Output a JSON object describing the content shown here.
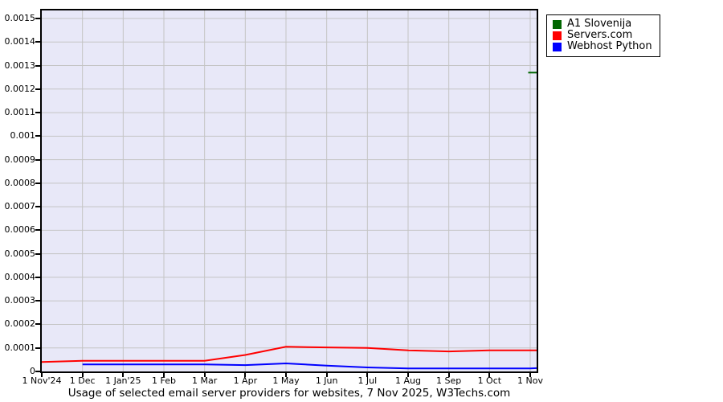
{
  "caption": "Usage of selected email server providers for websites, 7 Nov 2025, W3Techs.com",
  "chart_data": {
    "type": "line",
    "title": "Usage of selected email server providers for websites, 7 Nov 2025, W3Techs.com",
    "ylim": [
      0,
      0.0015
    ],
    "grid": true,
    "legend_position": "top-right-outside",
    "plot_bg": "#e8e8f8",
    "grid_color": "#c4c4c4",
    "axis_color": "#000000",
    "x_axis_note": "month_index 0 = 1 Nov 2024, 12 = 1 Nov 2025; axis extends to 12.16 = 7 Nov 2025",
    "y_ticks": [
      {
        "value": 0,
        "label": "0"
      },
      {
        "value": 0.0001,
        "label": "0.0001"
      },
      {
        "value": 0.0002,
        "label": "0.0002"
      },
      {
        "value": 0.0003,
        "label": "0.0003"
      },
      {
        "value": 0.0004,
        "label": "0.0004"
      },
      {
        "value": 0.0005,
        "label": "0.0005"
      },
      {
        "value": 0.0006,
        "label": "0.0006"
      },
      {
        "value": 0.0007,
        "label": "0.0007"
      },
      {
        "value": 0.0008,
        "label": "0.0008"
      },
      {
        "value": 0.0009,
        "label": "0.0009"
      },
      {
        "value": 0.001,
        "label": "0.001"
      },
      {
        "value": 0.0011,
        "label": "0.0011"
      },
      {
        "value": 0.0012,
        "label": "0.0012"
      },
      {
        "value": 0.0013,
        "label": "0.0013"
      },
      {
        "value": 0.0014,
        "label": "0.0014"
      },
      {
        "value": 0.0015,
        "label": "0.0015"
      }
    ],
    "x_ticks": [
      {
        "month_index": 0,
        "label": "1 Nov'24"
      },
      {
        "month_index": 1,
        "label": "1 Dec"
      },
      {
        "month_index": 2,
        "label": "1 Jan'25"
      },
      {
        "month_index": 3,
        "label": "1 Feb"
      },
      {
        "month_index": 4,
        "label": "1 Mar"
      },
      {
        "month_index": 5,
        "label": "1 Apr"
      },
      {
        "month_index": 6,
        "label": "1 May"
      },
      {
        "month_index": 7,
        "label": "1 Jun"
      },
      {
        "month_index": 8,
        "label": "1 Jul"
      },
      {
        "month_index": 9,
        "label": "1 Aug"
      },
      {
        "month_index": 10,
        "label": "1 Sep"
      },
      {
        "month_index": 11,
        "label": "1 Oct"
      },
      {
        "month_index": 12,
        "label": "1 Nov"
      }
    ],
    "series": [
      {
        "name": "A1 Slovenija",
        "color": "#006600",
        "points": [
          [
            11.95,
            0.00127
          ],
          [
            12.16,
            0.00127
          ]
        ]
      },
      {
        "name": "Servers.com",
        "color": "#ff0000",
        "points": [
          [
            0,
            4e-05
          ],
          [
            1,
            4.5e-05
          ],
          [
            2,
            4.5e-05
          ],
          [
            3,
            4.5e-05
          ],
          [
            4,
            4.5e-05
          ],
          [
            5,
            7e-05
          ],
          [
            6,
            0.000105
          ],
          [
            7,
            0.000102
          ],
          [
            8,
            0.0001
          ],
          [
            9,
            9e-05
          ],
          [
            10,
            8.5e-05
          ],
          [
            11,
            9e-05
          ],
          [
            12,
            9e-05
          ],
          [
            12.16,
            9e-05
          ]
        ]
      },
      {
        "name": "Webhost Python",
        "color": "#0000ff",
        "points": [
          [
            1,
            3e-05
          ],
          [
            2,
            3e-05
          ],
          [
            3,
            3e-05
          ],
          [
            4,
            3e-05
          ],
          [
            5,
            2.7e-05
          ],
          [
            6,
            3.4e-05
          ],
          [
            7,
            2.5e-05
          ],
          [
            8,
            1.7e-05
          ],
          [
            9,
            1.3e-05
          ],
          [
            10,
            1.3e-05
          ],
          [
            11,
            1.3e-05
          ],
          [
            12,
            1.3e-05
          ],
          [
            12.16,
            1.4e-05
          ]
        ]
      }
    ]
  }
}
